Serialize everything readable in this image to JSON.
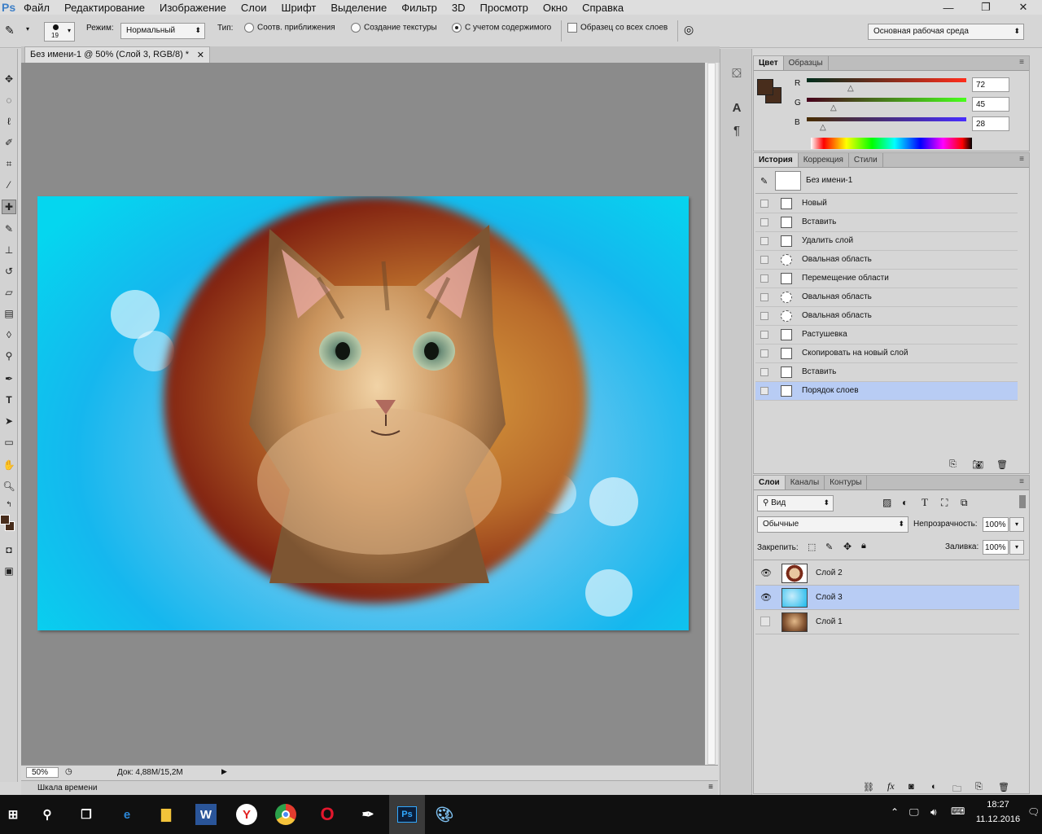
{
  "app": {
    "logo": "Ps"
  },
  "menu": [
    "Файл",
    "Редактирование",
    "Изображение",
    "Слои",
    "Шрифт",
    "Выделение",
    "Фильтр",
    "3D",
    "Просмотр",
    "Окно",
    "Справка"
  ],
  "options": {
    "brush_size": "19",
    "mode_label": "Режим:",
    "mode_value": "Нормальный",
    "type_label": "Тип:",
    "type_options": [
      "Соотв. приближения",
      "Создание текстуры",
      "С учетом содержимого"
    ],
    "sample_all_label": "Образец со всех слоев",
    "workspace": "Основная рабочая среда"
  },
  "document": {
    "tab_title": "Без имени-1 @ 50% (Слой 3, RGB/8) *",
    "zoom": "50%",
    "doc_size": "Док: 4,88M/15,2M",
    "timeline_label": "Шкала времени"
  },
  "color_panel": {
    "tabs": [
      "Цвет",
      "Образцы"
    ],
    "channels": [
      {
        "name": "R",
        "value": "72"
      },
      {
        "name": "G",
        "value": "45"
      },
      {
        "name": "B",
        "value": "28"
      }
    ],
    "fg_color": "#482d1c",
    "bg_color": "#482d1c"
  },
  "history_panel": {
    "tabs": [
      "История",
      "Коррекция",
      "Стили"
    ],
    "snapshot": "Без имени-1",
    "items": [
      {
        "label": "Новый",
        "icon": "document-icon"
      },
      {
        "label": "Вставить",
        "icon": "document-icon"
      },
      {
        "label": "Удалить слой",
        "icon": "document-icon"
      },
      {
        "label": "Овальная область",
        "icon": "ellipse-select-icon"
      },
      {
        "label": "Перемещение области",
        "icon": "document-icon"
      },
      {
        "label": "Овальная область",
        "icon": "ellipse-select-icon"
      },
      {
        "label": "Овальная область",
        "icon": "ellipse-select-icon"
      },
      {
        "label": "Растушевка",
        "icon": "document-icon"
      },
      {
        "label": "Скопировать на новый слой",
        "icon": "document-icon"
      },
      {
        "label": "Вставить",
        "icon": "document-icon"
      },
      {
        "label": "Порядок слоев",
        "icon": "document-icon",
        "selected": true
      }
    ]
  },
  "layers_panel": {
    "tabs": [
      "Слои",
      "Каналы",
      "Контуры"
    ],
    "filter": "Вид",
    "blend_mode": "Обычные",
    "opacity_label": "Непрозрачность:",
    "opacity": "100%",
    "lock_label": "Закрепить:",
    "fill_label": "Заливка:",
    "fill": "100%",
    "layers": [
      {
        "name": "Слой 2",
        "visible": true,
        "selected": false
      },
      {
        "name": "Слой 3",
        "visible": true,
        "selected": true
      },
      {
        "name": "Слой 1",
        "visible": false,
        "selected": false
      }
    ]
  },
  "taskbar": {
    "time": "18:27",
    "date": "11.12.2016"
  }
}
